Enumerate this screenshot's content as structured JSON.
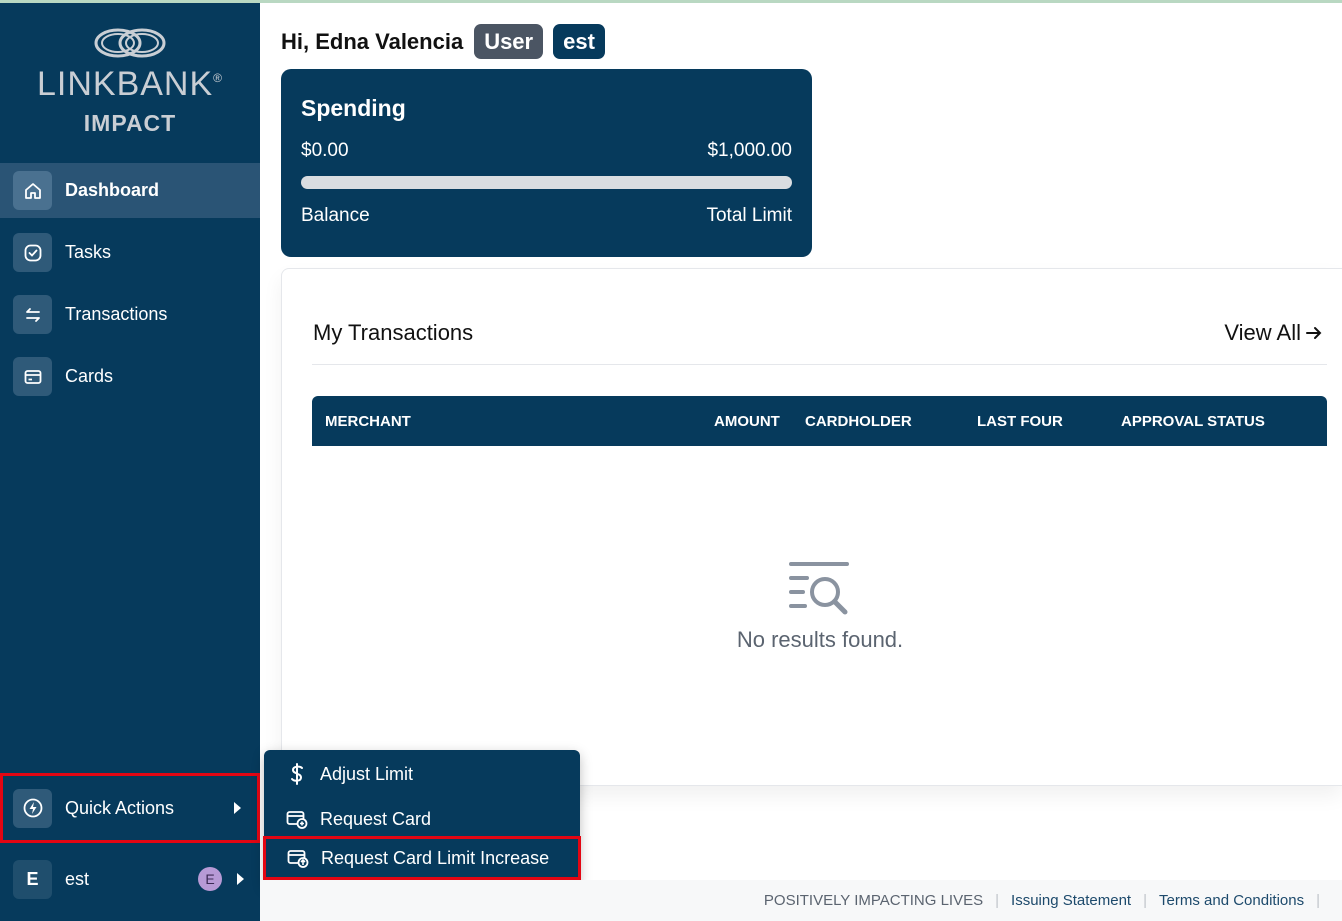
{
  "brand": {
    "name": "LINKBANK",
    "registered": "®",
    "sub": "IMPACT"
  },
  "sidebar": {
    "items": [
      {
        "label": "Dashboard",
        "icon": "home-icon",
        "active": true
      },
      {
        "label": "Tasks",
        "icon": "check-circle-icon"
      },
      {
        "label": "Transactions",
        "icon": "arrows-swap-icon"
      },
      {
        "label": "Cards",
        "icon": "credit-card-icon"
      }
    ],
    "quick_actions": {
      "label": "Quick Actions",
      "icon": "lightning-icon"
    },
    "user": {
      "initial": "E",
      "name": "est",
      "badge": "E"
    }
  },
  "header": {
    "greeting": "Hi, Edna Valencia",
    "role_pill": "User",
    "org_pill": "est"
  },
  "spending": {
    "title": "Spending",
    "balance_value": "$0.00",
    "limit_value": "$1,000.00",
    "balance_label": "Balance",
    "limit_label": "Total Limit",
    "progress_fraction": 0
  },
  "transactions": {
    "title": "My Transactions",
    "view_all": "View All",
    "columns": [
      "MERCHANT",
      "AMOUNT",
      "CARDHOLDER",
      "LAST FOUR",
      "APPROVAL STATUS"
    ],
    "empty_text": "No results found."
  },
  "quick_menu": {
    "items": [
      {
        "label": "Adjust Limit",
        "icon": "dollar-icon"
      },
      {
        "label": "Request Card",
        "icon": "card-plus-icon"
      },
      {
        "label": "Request Card Limit Increase",
        "icon": "card-up-icon",
        "highlighted": true
      }
    ]
  },
  "footer": {
    "tagline": "POSITIVELY IMPACTING LIVES",
    "issuing": "Issuing Statement",
    "terms": "Terms and Conditions"
  },
  "colors": {
    "navy": "#063a5c",
    "active": "#2a5475",
    "highlight": "#e30613"
  }
}
